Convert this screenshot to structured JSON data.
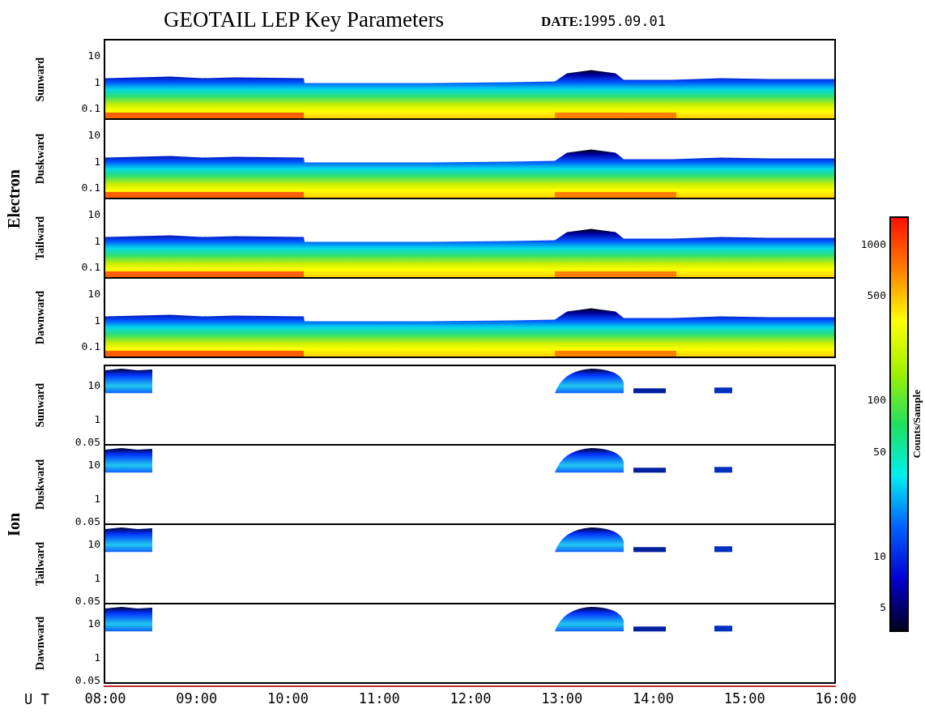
{
  "title": "GEOTAIL LEP Key Parameters",
  "date": {
    "label": "DATE:",
    "value": "1995.09.01"
  },
  "groups": [
    {
      "name": "Electron",
      "kind": "electron",
      "panels": [
        {
          "label": "Sunward",
          "yticks": [
            "10",
            "1",
            "0.1"
          ]
        },
        {
          "label": "Duskward",
          "yticks": [
            "10",
            "1",
            "0.1"
          ]
        },
        {
          "label": "Tailward",
          "yticks": [
            "10",
            "1",
            "0.1"
          ]
        },
        {
          "label": "Dawnward",
          "yticks": [
            "10",
            "1",
            "0.1"
          ]
        }
      ]
    },
    {
      "name": "Ion",
      "kind": "ion",
      "panels": [
        {
          "label": "Sunward",
          "yticks": [
            "10",
            "1",
            "0.05"
          ]
        },
        {
          "label": "Duskward",
          "yticks": [
            "10",
            "1",
            "0.05"
          ]
        },
        {
          "label": "Tailward",
          "yticks": [
            "10",
            "1",
            "0.05"
          ]
        },
        {
          "label": "Dawnward",
          "yticks": [
            "10",
            "1",
            "0.05"
          ]
        }
      ]
    }
  ],
  "x_axis": {
    "label": "U T",
    "ticks": [
      "08:00",
      "09:00",
      "10:00",
      "11:00",
      "12:00",
      "13:00",
      "14:00",
      "15:00",
      "16:00"
    ]
  },
  "colorbar": {
    "label": "Counts/Sample",
    "ticks": [
      "1000",
      "500",
      "100",
      "50",
      "10",
      "5"
    ]
  }
}
